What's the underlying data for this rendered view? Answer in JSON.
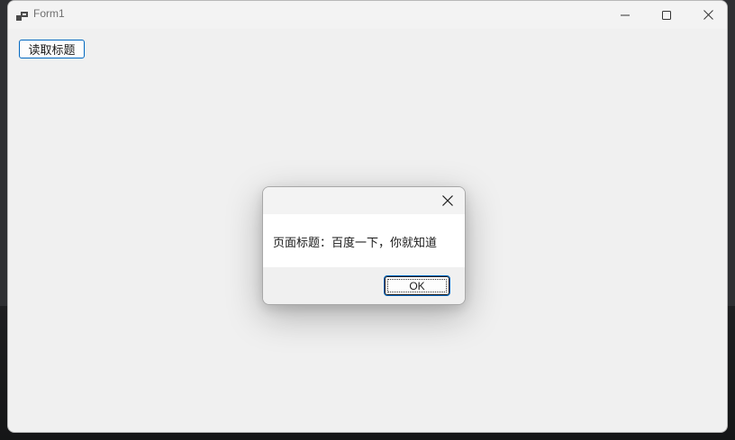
{
  "window": {
    "title": "Form1",
    "app_icon": "winforms-app-icon",
    "controls": {
      "minimize_icon": "minimize-icon",
      "maximize_icon": "maximize-icon",
      "close_icon": "close-icon"
    }
  },
  "form": {
    "read_title_button_label": "读取标题"
  },
  "dialog": {
    "message": "页面标题：百度一下，你就知道",
    "ok_label": "OK",
    "close_icon": "close-icon"
  },
  "colors": {
    "accent": "#0067c0",
    "window_bg": "#f0f0f0",
    "title_text": "#6f6f6f"
  }
}
